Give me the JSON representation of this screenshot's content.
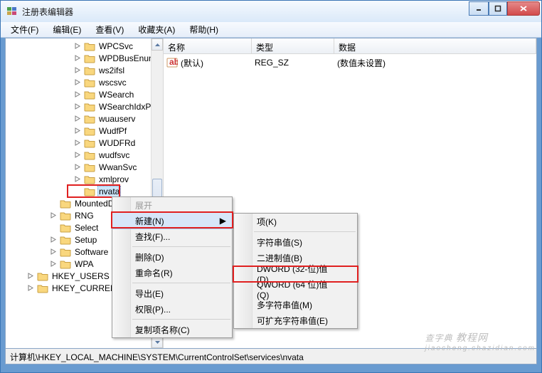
{
  "window": {
    "title": "注册表编辑器"
  },
  "menu": {
    "file": "文件(F)",
    "edit": "编辑(E)",
    "view": "查看(V)",
    "favorites": "收藏夹(A)",
    "help": "帮助(H)"
  },
  "tree": {
    "items": [
      {
        "label": "WPCSvc",
        "indent": 96
      },
      {
        "label": "WPDBusEnum",
        "indent": 96
      },
      {
        "label": "ws2ifsl",
        "indent": 96
      },
      {
        "label": "wscsvc",
        "indent": 96
      },
      {
        "label": "WSearch",
        "indent": 96
      },
      {
        "label": "WSearchIdxPi",
        "indent": 96
      },
      {
        "label": "wuauserv",
        "indent": 96
      },
      {
        "label": "WudfPf",
        "indent": 96
      },
      {
        "label": "WUDFRd",
        "indent": 96
      },
      {
        "label": "wudfsvc",
        "indent": 96
      },
      {
        "label": "WwanSvc",
        "indent": 96
      },
      {
        "label": "xmlprov",
        "indent": 96
      },
      {
        "label": "nvata",
        "indent": 96,
        "selected": true,
        "no_toggle": true
      },
      {
        "label": "MountedDevices",
        "indent": 62,
        "no_toggle": true
      },
      {
        "label": "RNG",
        "indent": 62
      },
      {
        "label": "Select",
        "indent": 62,
        "no_toggle": true
      },
      {
        "label": "Setup",
        "indent": 62
      },
      {
        "label": "Software",
        "indent": 62
      },
      {
        "label": "WPA",
        "indent": 62
      },
      {
        "label": "HKEY_USERS",
        "indent": 30
      },
      {
        "label": "HKEY_CURRENT_CONFIG",
        "indent": 30
      }
    ]
  },
  "list": {
    "columns": {
      "name": "名称",
      "type": "类型",
      "data": "数据"
    },
    "rows": [
      {
        "name": "(默认)",
        "type": "REG_SZ",
        "data": "(数值未设置)"
      }
    ]
  },
  "context_menu": {
    "expand": "展开",
    "new": "新建(N)",
    "find": "查找(F)...",
    "delete": "删除(D)",
    "rename": "重命名(R)",
    "export": "导出(E)",
    "permissions": "权限(P)...",
    "copy_key_name": "复制项名称(C)"
  },
  "submenu": {
    "key": "项(K)",
    "string": "字符串值(S)",
    "binary": "二进制值(B)",
    "dword": "DWORD (32-位)值(D)",
    "qword": "QWORD (64 位)值(Q)",
    "multi_string": "多字符串值(M)",
    "expandable_string": "可扩充字符串值(E)"
  },
  "statusbar": {
    "path": "计算机\\HKEY_LOCAL_MACHINE\\SYSTEM\\CurrentControlSet\\services\\nvata"
  },
  "watermark": {
    "main": "查字典",
    "sub": "jiaocheng.chazidian.com"
  }
}
